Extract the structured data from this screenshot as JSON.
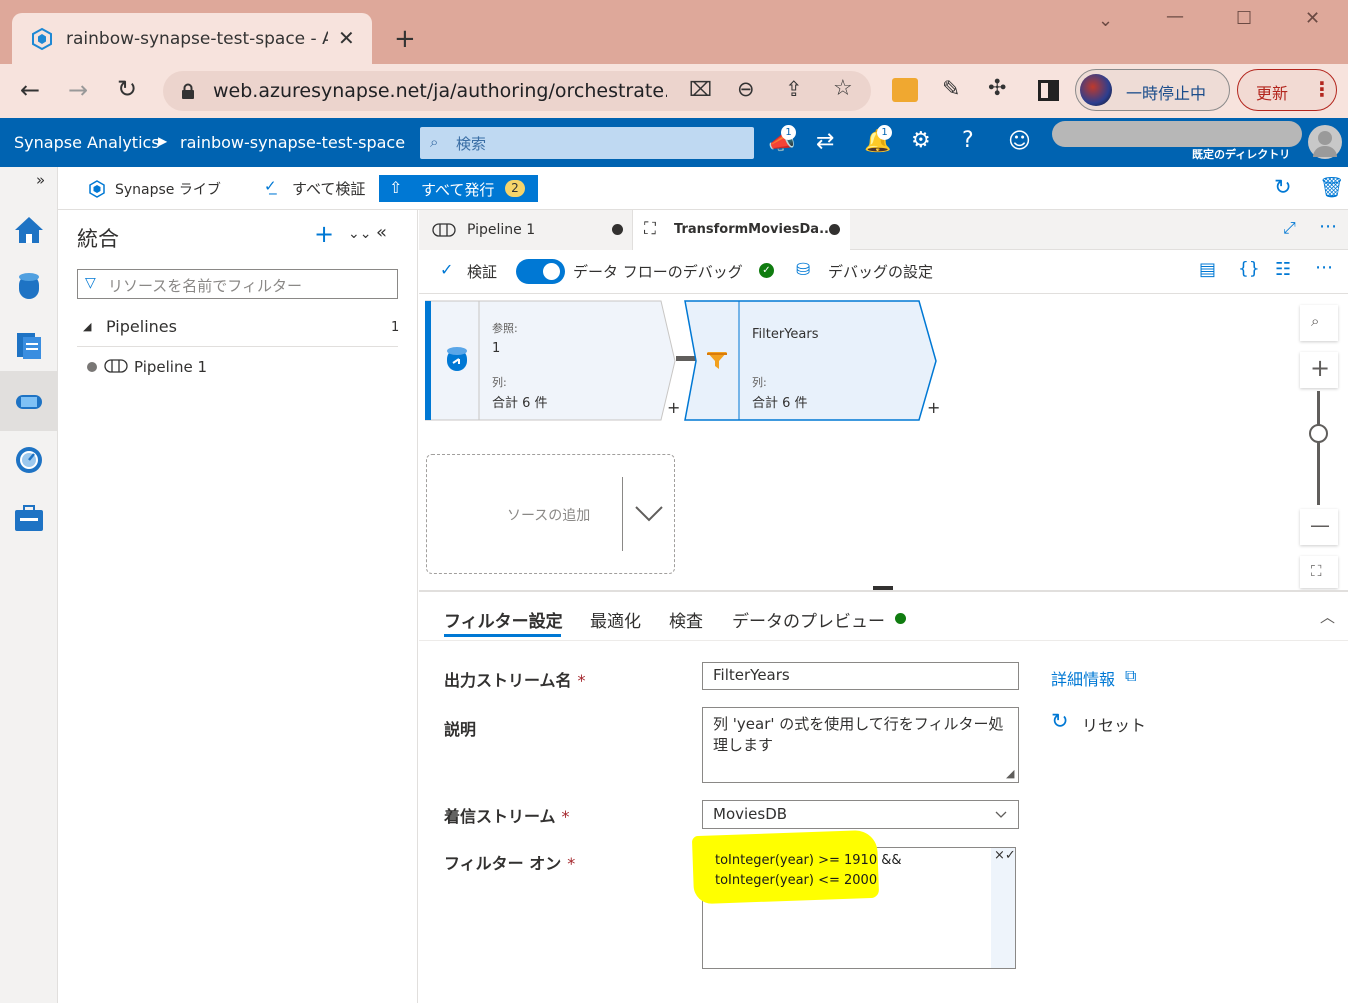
{
  "browser": {
    "tab_title": "rainbow-synapse-test-space - Azure",
    "url": "web.azuresynapse.net/ja/authoring/orchestrate...",
    "profile_label": "一時停止中",
    "update_label": "更新"
  },
  "header": {
    "app": "Synapse Analytics",
    "workspace": "rainbow-synapse-test-space",
    "search_placeholder": "検索",
    "notif_badge_1": "1",
    "notif_badge_2": "1",
    "directory": "既定のディレクトリ"
  },
  "subbar": {
    "live": "Synapse ライブ",
    "validate_all": "すべて検証",
    "publish_all": "すべて発行",
    "publish_count": "2"
  },
  "explorer": {
    "title": "統合",
    "filter_placeholder": "リソースを名前でフィルター",
    "group": "Pipelines",
    "group_count": "1",
    "item": "Pipeline 1"
  },
  "tabs": [
    {
      "label": "Pipeline 1"
    },
    {
      "label": "TransformMoviesDa..."
    }
  ],
  "canvas_toolbar": {
    "validate": "検証",
    "debug": "データ フローのデバッグ",
    "debug_settings": "デバッグの設定"
  },
  "nodes": {
    "source": {
      "ref_label": "参照:",
      "ref_value": "1",
      "cols_label": "列:",
      "cols_value": "合計 6 件"
    },
    "filter": {
      "name": "FilterYears",
      "cols_label": "列:",
      "cols_value": "合計 6 件"
    },
    "add_source": "ソースの追加"
  },
  "bottom_tabs": [
    "フィルター設定",
    "最適化",
    "検査",
    "データのプレビュー"
  ],
  "form": {
    "output_label": "出力ストリーム名",
    "output_value": "FilterYears",
    "desc_label": "説明",
    "desc_value": "列 'year' の式を使用して行をフィルター処理します",
    "incoming_label": "着信ストリーム",
    "incoming_value": "MoviesDB",
    "filter_label": "フィルター オン",
    "filter_line1": "toInteger(year) >= 1910 &&",
    "filter_line2": "toInteger(year) <= 2000",
    "more_info": "詳細情報",
    "reset": "リセット",
    "required": "*"
  },
  "colors": {
    "accent": "#0078d4",
    "header": "#0063b1",
    "highlight": "#ffff00",
    "ok": "#107c10"
  }
}
